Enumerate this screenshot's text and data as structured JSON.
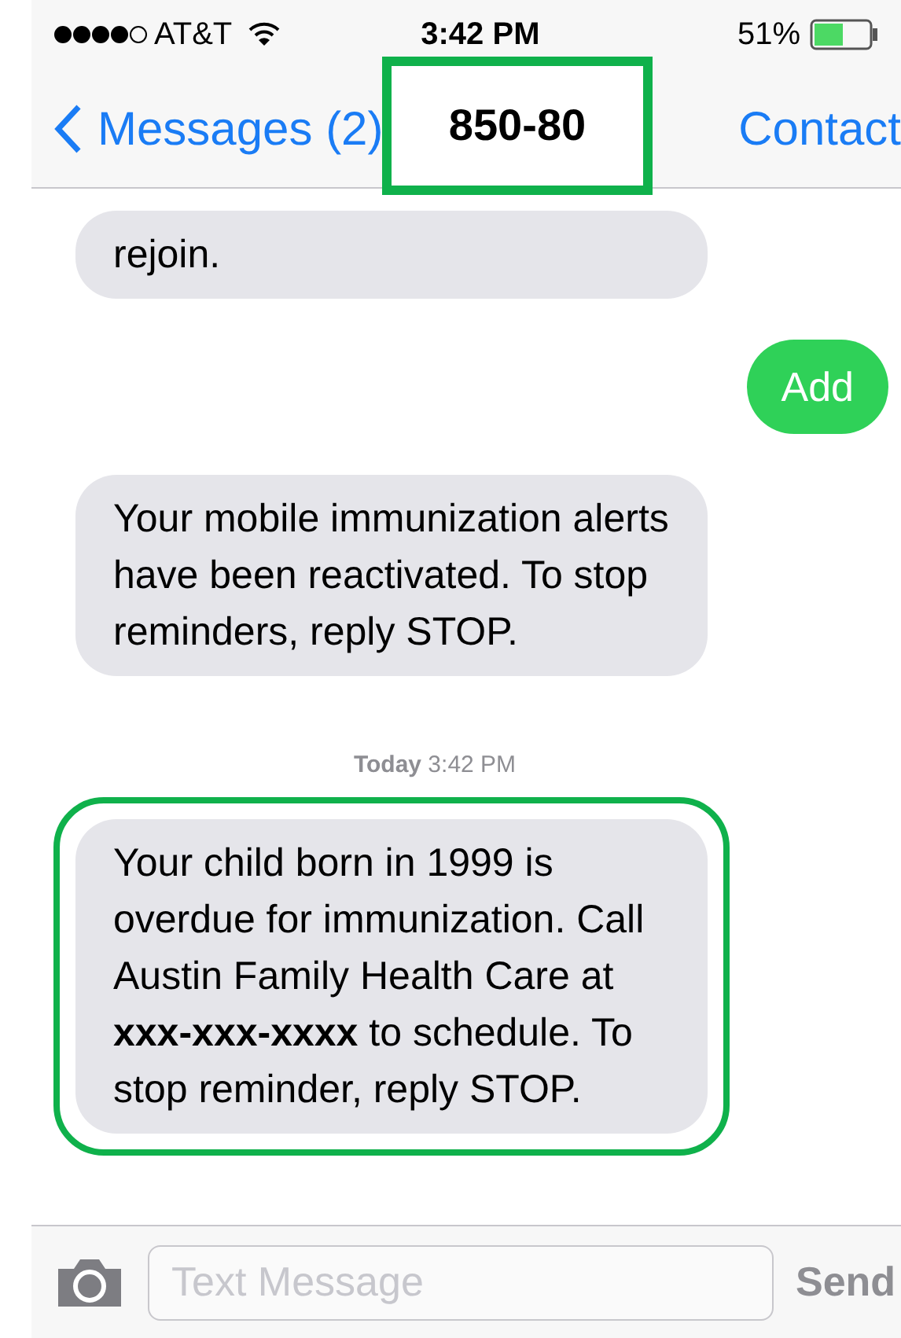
{
  "status_bar": {
    "carrier": "AT&T",
    "time": "3:42 PM",
    "battery": "51%"
  },
  "nav": {
    "back": "Messages (2)",
    "title": "850-80",
    "title_highlighted": true,
    "action": "Contact"
  },
  "messages": [
    {
      "kind": "received",
      "text": "rejoin.",
      "highlighted": false
    },
    {
      "kind": "sent",
      "text": "Add",
      "highlighted": false
    },
    {
      "kind": "received",
      "text": "Your mobile immunization alerts have been reactivated. To stop reminders, reply STOP.",
      "highlighted": false
    },
    {
      "kind": "timestamp",
      "text": "**Today** 3:42 PM"
    },
    {
      "kind": "received",
      "text": "Your child born in 1999 is overdue for immunization. Call Austin Family Health Care at **xxx-xxx-xxxx** to schedule. To stop reminder, reply STOP.",
      "highlighted": true
    }
  ],
  "compose": {
    "placeholder": "Text Message",
    "send": "Send"
  }
}
